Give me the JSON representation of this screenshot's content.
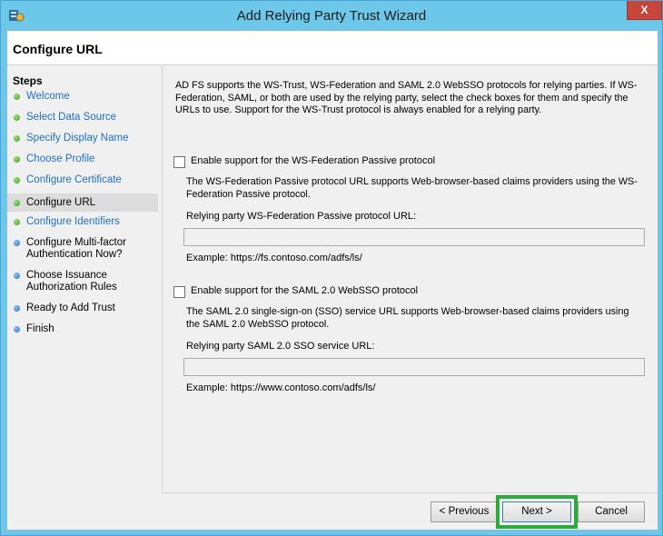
{
  "window": {
    "title": "Add Relying Party Trust Wizard",
    "close_label": "X"
  },
  "page": {
    "title": "Configure URL"
  },
  "steps": {
    "heading": "Steps",
    "items": [
      {
        "label": "Welcome",
        "status": "done"
      },
      {
        "label": "Select Data Source",
        "status": "done"
      },
      {
        "label": "Specify Display Name",
        "status": "done"
      },
      {
        "label": "Choose Profile",
        "status": "done"
      },
      {
        "label": "Configure Certificate",
        "status": "done"
      },
      {
        "label": "Configure URL",
        "status": "current"
      },
      {
        "label": "Configure Identifiers",
        "status": "pending"
      },
      {
        "label": "Configure Multi-factor Authentication Now?",
        "status": "pending"
      },
      {
        "label": "Choose Issuance Authorization Rules",
        "status": "pending"
      },
      {
        "label": "Ready to Add Trust",
        "status": "pending"
      },
      {
        "label": "Finish",
        "status": "pending"
      }
    ]
  },
  "content": {
    "intro": "AD FS supports the WS-Trust, WS-Federation and SAML 2.0 WebSSO protocols for relying parties.  If WS-Federation, SAML, or both are used by the relying party, select the check boxes for them and specify the URLs to use.  Support for the WS-Trust protocol is always enabled for a relying party.",
    "wsfed": {
      "checkbox_label": "Enable support for the WS-Federation Passive protocol",
      "checked": false,
      "description": "The WS-Federation Passive protocol URL supports Web-browser-based claims providers using the WS-Federation Passive protocol.",
      "field_label": "Relying party WS-Federation Passive protocol URL:",
      "value": "",
      "example": "Example: https://fs.contoso.com/adfs/ls/"
    },
    "saml": {
      "checkbox_label": "Enable support for the SAML 2.0 WebSSO protocol",
      "checked": false,
      "description": "The SAML 2.0 single-sign-on (SSO) service URL supports Web-browser-based claims providers using the SAML 2.0 WebSSO protocol.",
      "field_label": "Relying party SAML 2.0 SSO service URL:",
      "value": "",
      "example": "Example: https://www.contoso.com/adfs/ls/"
    }
  },
  "buttons": {
    "previous": "< Previous",
    "next": "Next >",
    "cancel": "Cancel"
  },
  "colors": {
    "titlebar": "#6cc7e8",
    "link": "#1f6fc4",
    "highlight": "#2eaa3c",
    "close": "#c7463c"
  }
}
